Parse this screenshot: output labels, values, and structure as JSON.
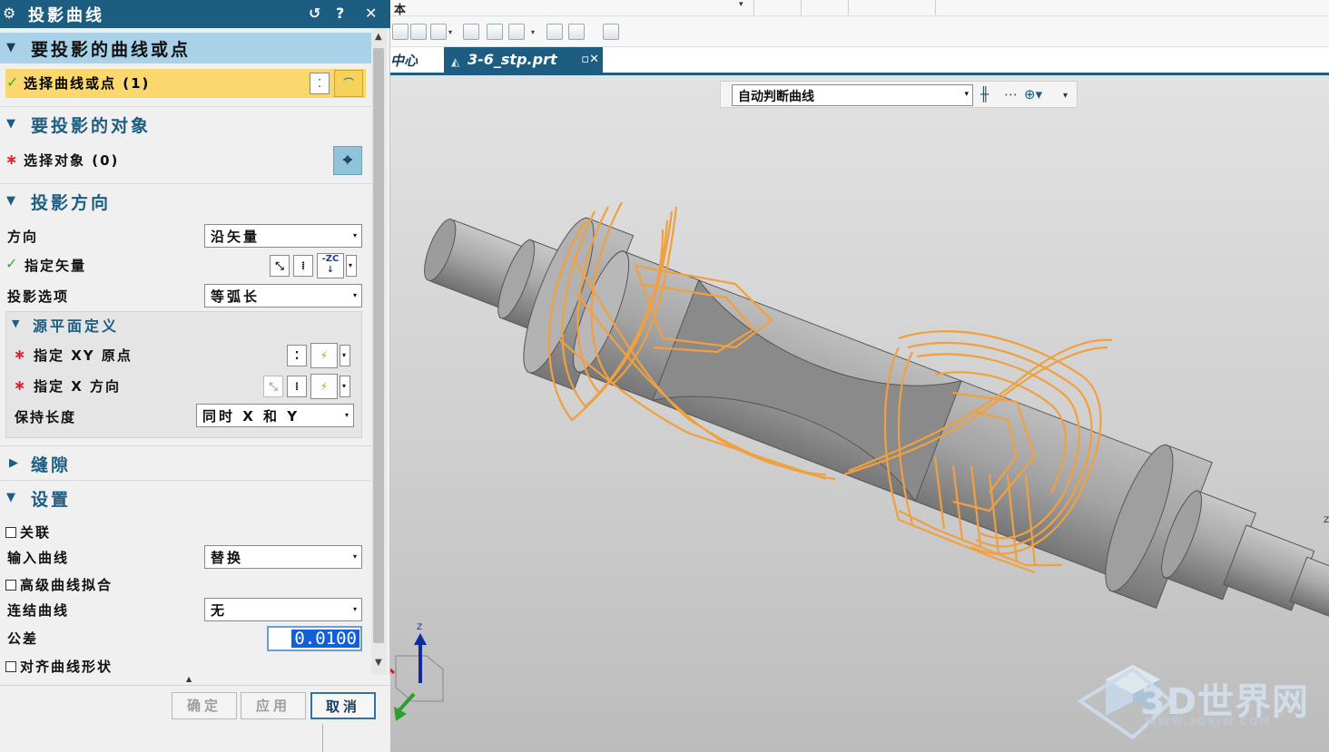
{
  "dialog": {
    "title": "投影曲线",
    "sections": {
      "curves": {
        "header": "要投影的曲线或点",
        "select_label": "选择曲线或点 (1)"
      },
      "objects": {
        "header": "要投影的对象",
        "select_label": "选择对象 (0)"
      },
      "direction": {
        "header": "投影方向",
        "direction_label": "方向",
        "direction_value": "沿矢量",
        "vector_label": "指定矢量",
        "vector_icon_text": "-ZC",
        "option_label": "投影选项",
        "option_value": "等弧长",
        "source_plane": {
          "header": "源平面定义",
          "xy_origin_label": "指定 XY 原点",
          "x_direction_label": "指定 X 方向",
          "keep_length_label": "保持长度",
          "keep_length_value": "同时 X 和 Y"
        }
      },
      "gap": {
        "header": "缝隙"
      },
      "settings": {
        "header": "设置",
        "associative_label": "关联",
        "input_curve_label": "输入曲线",
        "input_curve_value": "替换",
        "advanced_fit_label": "高级曲线拟合",
        "join_curves_label": "连结曲线",
        "join_curves_value": "无",
        "tolerance_label": "公差",
        "tolerance_value": "0.0100",
        "align_shape_label": "对齐曲线形状"
      }
    },
    "buttons": {
      "ok": "确定",
      "apply": "应用",
      "cancel": "取消"
    }
  },
  "app": {
    "topbar_fragment": "本",
    "tab_left_fragment": "中心",
    "active_tab": "3-6_stp.prt",
    "selection_filter": "自动判断曲线",
    "triad_z": "Z",
    "triad_z_right": "Z"
  },
  "watermark": {
    "text": "3D世界网",
    "url": "WWW.3DSJW.COM"
  },
  "colors": {
    "titlebar": "#1d5d82",
    "section_highlight": "#a9d2e8",
    "selection_row": "#fad86d",
    "projected_curves": "#f0a040",
    "model_body": "#a9a9a9"
  }
}
